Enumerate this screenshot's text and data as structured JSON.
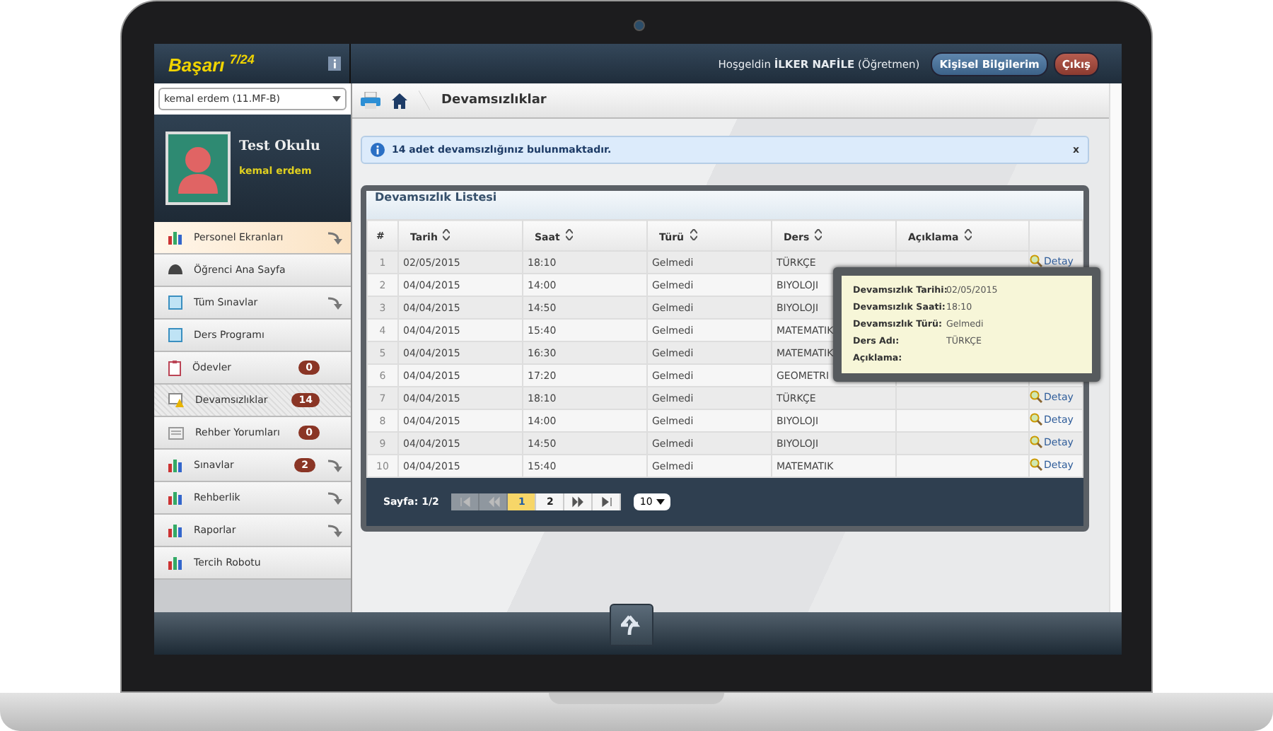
{
  "app": {
    "logo": "Başarı $^{7/24}$"
  },
  "topbar": {
    "welcome": "Hoşgeldin **İLKER NAFİLE** (Öğretmen)",
    "buttons": [
      {
        "label": "Kişisel Bilgilerim",
        "kind": "primary"
      },
      {
        "label": "Çıkış",
        "kind": "danger"
      }
    ]
  },
  "student_select": {
    "value": "kemal erdem (11.MF-B)"
  },
  "profile": {
    "school": "Test Okulu",
    "name": "kemal erdem"
  },
  "sidebar": {
    "items": [
      {
        "label": "Personel Ekranları",
        "kind": "chart",
        "submenu": true,
        "highlighted": true,
        "selected": false
      },
      {
        "label": "Öğrenci Ana Sayfa",
        "kind": "helmet",
        "submenu": false,
        "highlighted": false,
        "selected": false
      },
      {
        "label": "Tüm Sınavlar",
        "kind": "window",
        "submenu": true,
        "highlighted": false,
        "selected": false
      },
      {
        "label": "Ders Programı",
        "kind": "window",
        "submenu": false,
        "highlighted": false,
        "selected": false
      },
      {
        "label": "Ödevler",
        "kind": "clipboard",
        "badge": "0",
        "submenu": false,
        "highlighted": false,
        "selected": false
      },
      {
        "label": "Devamsızlıklar",
        "kind": "warning",
        "badge": "14",
        "submenu": false,
        "highlighted": false,
        "selected": true
      },
      {
        "label": "Rehber Yorumları",
        "kind": "card",
        "badge": "0",
        "submenu": false,
        "highlighted": false,
        "selected": false
      },
      {
        "label": "Sınavlar",
        "kind": "chart",
        "badge": "2",
        "submenu": true,
        "highlighted": false,
        "selected": false
      },
      {
        "label": "Rehberlik",
        "kind": "chart",
        "submenu": true,
        "highlighted": false,
        "selected": false
      },
      {
        "label": "Raporlar",
        "kind": "chart",
        "submenu": true,
        "highlighted": false,
        "selected": false
      },
      {
        "label": "Tercih Robotu",
        "kind": "chart",
        "submenu": false,
        "highlighted": false,
        "selected": false
      }
    ]
  },
  "breadcrumb": {
    "title": "Devamsızlıklar"
  },
  "alert": {
    "text": "14 adet devamsızlığınız bulunmaktadır.",
    "close": "x"
  },
  "table": {
    "title": "Devamsızlık Listesi",
    "columns": [
      {
        "label": "#",
        "sortable": false
      },
      {
        "label": "Tarih",
        "sortable": true
      },
      {
        "label": "Saat",
        "sortable": true
      },
      {
        "label": "Türü",
        "sortable": true
      },
      {
        "label": "Ders",
        "sortable": true
      },
      {
        "label": "Açıklama",
        "sortable": true
      }
    ],
    "rows": [
      {
        "cells": [
          "1",
          "02/05/2015",
          "18:10",
          "Gelmedi",
          "TÜRKÇE",
          ""
        ],
        "action": "Detay"
      },
      {
        "cells": [
          "2",
          "04/04/2015",
          "14:00",
          "Gelmedi",
          "BIYOLOJI",
          ""
        ]
      },
      {
        "cells": [
          "3",
          "04/04/2015",
          "14:50",
          "Gelmedi",
          "BIYOLOJI",
          ""
        ]
      },
      {
        "cells": [
          "4",
          "04/04/2015",
          "15:40",
          "Gelmedi",
          "MATEMATIK",
          ""
        ]
      },
      {
        "cells": [
          "5",
          "04/04/2015",
          "16:30",
          "Gelmedi",
          "MATEMATIK",
          ""
        ]
      },
      {
        "cells": [
          "6",
          "04/04/2015",
          "17:20",
          "Gelmedi",
          "GEOMETRI",
          ""
        ]
      },
      {
        "cells": [
          "7",
          "04/04/2015",
          "18:10",
          "Gelmedi",
          "TÜRKÇE",
          ""
        ],
        "action": "Detay"
      },
      {
        "cells": [
          "8",
          "04/04/2015",
          "14:00",
          "Gelmedi",
          "BIYOLOJI",
          ""
        ],
        "action": "Detay"
      },
      {
        "cells": [
          "9",
          "04/04/2015",
          "14:50",
          "Gelmedi",
          "BIYOLOJI",
          ""
        ],
        "action": "Detay"
      },
      {
        "cells": [
          "10",
          "04/04/2015",
          "15:40",
          "Gelmedi",
          "MATEMATIK",
          ""
        ],
        "action": "Detay"
      }
    ]
  },
  "pagination": {
    "label": "Sayfa: 1/2",
    "buttons": [
      {
        "kind": "first",
        "disabled": true
      },
      {
        "kind": "prev",
        "disabled": true
      },
      {
        "kind": "page",
        "label": "1",
        "selected": true
      },
      {
        "kind": "page",
        "label": "2",
        "selected": false
      },
      {
        "kind": "next",
        "disabled": false
      },
      {
        "kind": "last",
        "disabled": false
      }
    ],
    "page_size": "10"
  },
  "tooltip": {
    "fields": [
      {
        "label": "Devamsızlık Tarihi:",
        "value": "02/05/2015"
      },
      {
        "label": "Devamsızlık Saati:",
        "value": "18:10"
      },
      {
        "label": "Devamsızlık Türü:",
        "value": "Gelmedi"
      },
      {
        "label": "Ders Adı:",
        "value": "TÜRKÇE"
      },
      {
        "label": "Açıklama:"
      }
    ]
  }
}
